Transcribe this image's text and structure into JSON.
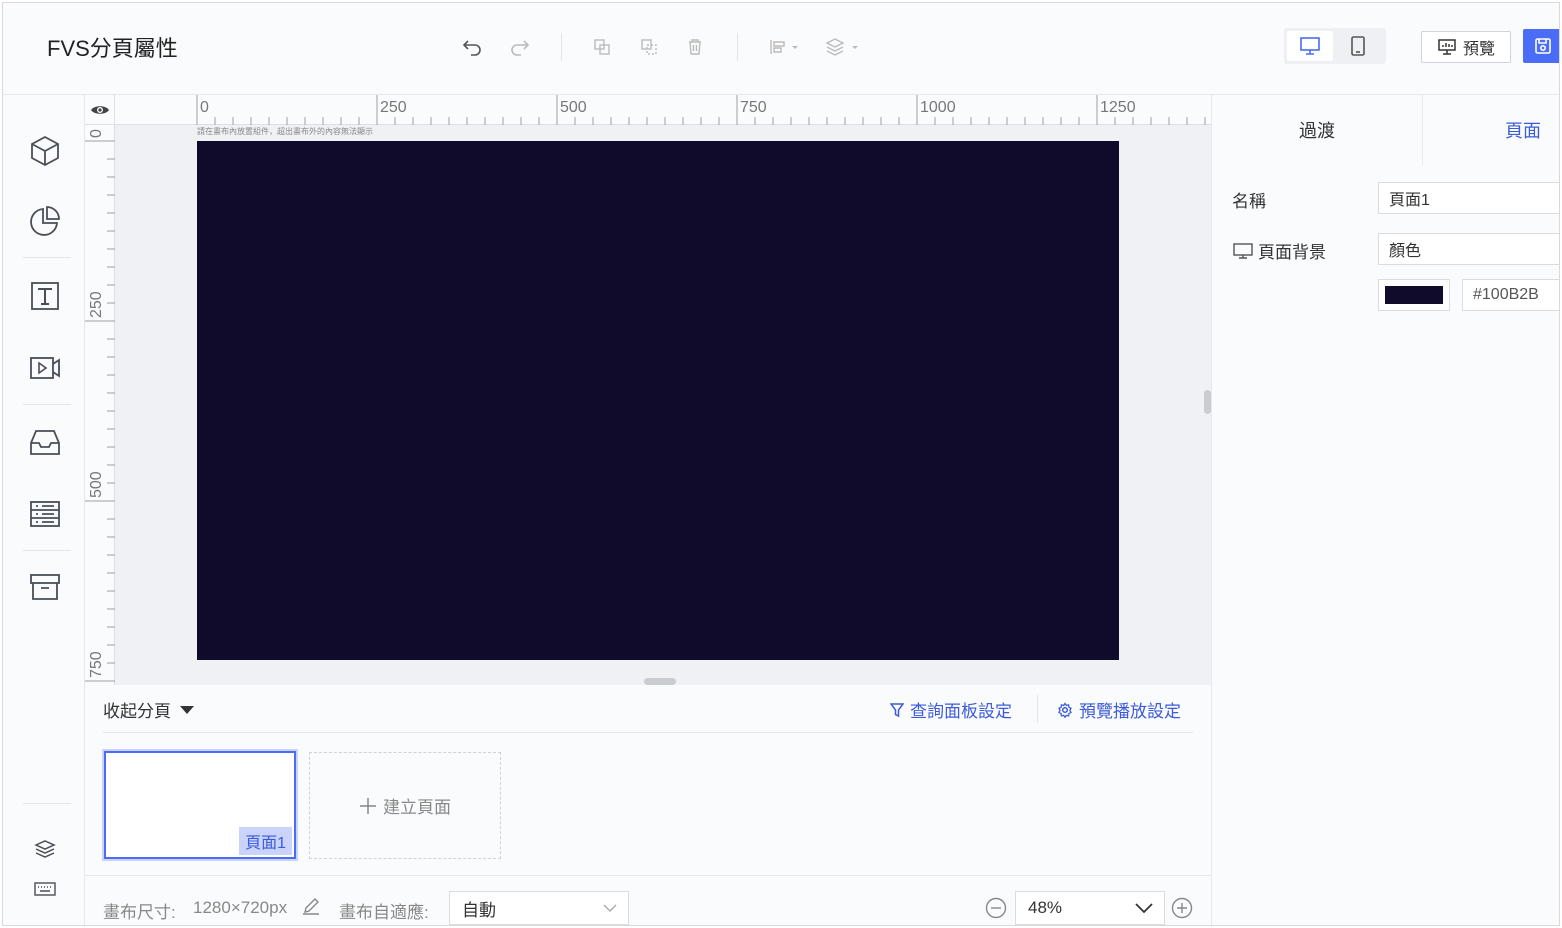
{
  "header": {
    "title": "FVS分頁屬性",
    "preview_label": "預覽"
  },
  "colors": {
    "accent": "#4a6cf7",
    "canvas_bg": "#100B2B",
    "link": "#3b5bdb"
  },
  "toolbar": {
    "icons": [
      "undo-icon",
      "redo-icon",
      "copy-icon",
      "paste-icon",
      "delete-icon",
      "align-icon",
      "layer-order-icon"
    ]
  },
  "sidebar": {
    "items": [
      "3d-model-icon",
      "pie-chart-icon",
      "text-icon",
      "video-icon",
      "inbox-icon",
      "server-list-icon",
      "archive-icon"
    ],
    "bottom": [
      "layers-icon",
      "keyboard-icon"
    ]
  },
  "canvas": {
    "hint": "請在畫布內放置組件，超出畫布外的內容無法顯示",
    "ruler_top_labels": [
      "0",
      "250",
      "500",
      "750",
      "1000",
      "1250"
    ],
    "ruler_left_labels": [
      "0",
      "250",
      "500",
      "750"
    ]
  },
  "pages_panel": {
    "collapse_label": "收起分頁",
    "query_panel_label": "查詢面板設定",
    "preview_play_label": "預覽播放設定",
    "pages": [
      {
        "label": "頁面1"
      }
    ],
    "add_page_label": "建立頁面"
  },
  "statusbar": {
    "canvas_size_label": "畫布尺寸:",
    "canvas_size_value": "1280×720px",
    "adapt_label": "畫布自適應:",
    "adapt_value": "自動",
    "zoom_value": "48%"
  },
  "right_panel": {
    "tabs": [
      "過渡",
      "頁面"
    ],
    "active_tab": "頁面",
    "name_label": "名稱",
    "name_value": "頁面1",
    "bg_label": "頁面背景",
    "bg_type": "顏色",
    "bg_hex": "#100B2B"
  }
}
